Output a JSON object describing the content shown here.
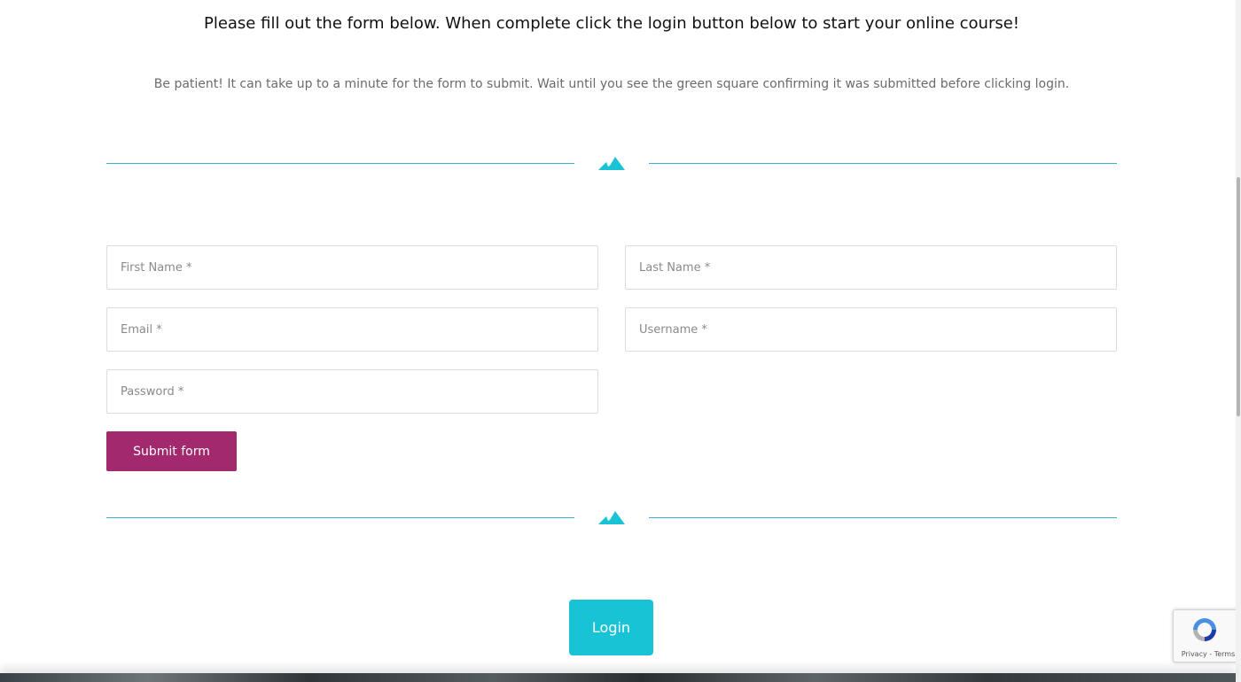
{
  "header": {
    "title": "Please fill out the form below. When complete click the login button below to start your online course!",
    "notice": "Be patient! It can take up to a minute for the form to submit. Wait until you see the green square confirming it was submitted before clicking login."
  },
  "form": {
    "first_name": {
      "placeholder": "First Name *",
      "value": ""
    },
    "last_name": {
      "placeholder": "Last Name *",
      "value": ""
    },
    "email": {
      "placeholder": "Email *",
      "value": ""
    },
    "username": {
      "placeholder": "Username *",
      "value": ""
    },
    "password": {
      "placeholder": "Password *",
      "value": ""
    },
    "submit_label": "Submit form"
  },
  "login": {
    "label": "Login"
  },
  "recaptcha": {
    "terms": "Privacy - Terms"
  },
  "colors": {
    "accent_teal": "#19c3d6",
    "divider_teal": "#2bb7c9",
    "submit_magenta": "#a3296e"
  },
  "icons": {
    "divider": "mountain-icon",
    "recaptcha": "recaptcha-logo-icon"
  }
}
